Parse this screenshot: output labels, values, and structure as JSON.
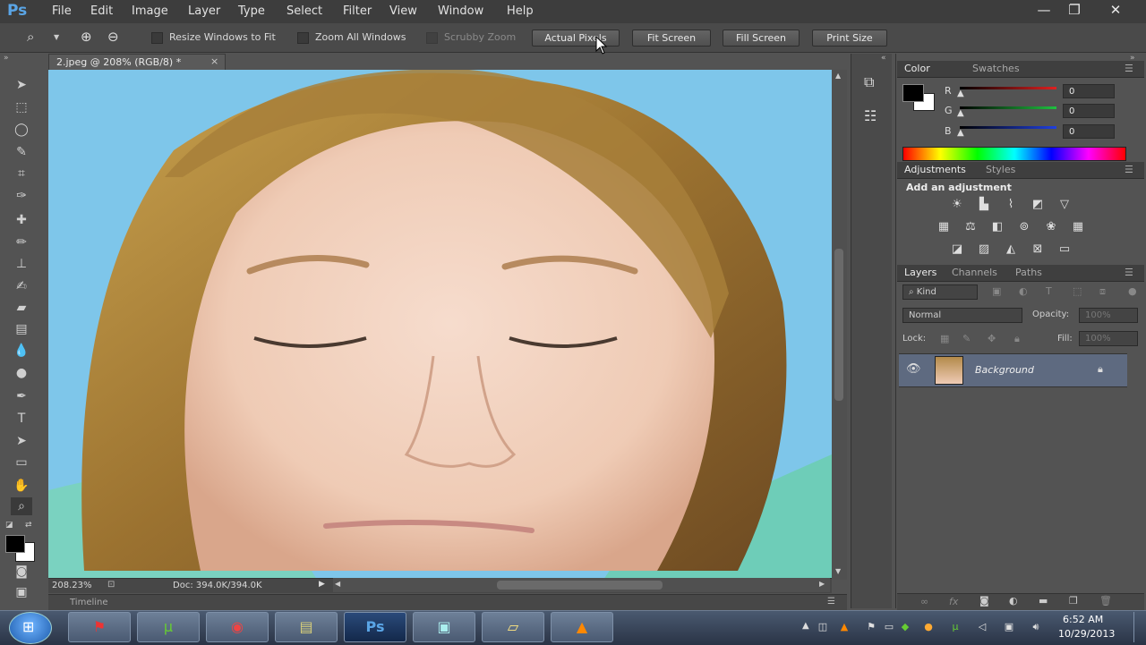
{
  "app": {
    "logo": "Ps"
  },
  "menu": [
    "File",
    "Edit",
    "Image",
    "Layer",
    "Type",
    "Select",
    "Filter",
    "View",
    "Window",
    "Help"
  ],
  "window_controls": {
    "minimize": "—",
    "restore": "❐",
    "close": "✕"
  },
  "options": {
    "resize_windows": "Resize Windows to Fit",
    "zoom_all": "Zoom All Windows",
    "scrubby": "Scrubby Zoom",
    "actual_pixels": "Actual Pixels",
    "fit_screen": "Fit Screen",
    "fill_screen": "Fill Screen",
    "print_size": "Print Size"
  },
  "document": {
    "tab_title": "2.jpeg @ 208% (RGB/8) *",
    "zoom": "208.23%",
    "doc_size": "Doc: 394.0K/394.0K"
  },
  "timeline_label": "Timeline",
  "color_panel": {
    "tabs": [
      "Color",
      "Swatches"
    ],
    "channels": [
      {
        "name": "R",
        "value": "0",
        "color": "#e02020"
      },
      {
        "name": "G",
        "value": "0",
        "color": "#20c040"
      },
      {
        "name": "B",
        "value": "0",
        "color": "#2040e0"
      }
    ]
  },
  "adjustments_panel": {
    "tabs": [
      "Adjustments",
      "Styles"
    ],
    "heading": "Add an adjustment"
  },
  "layers_panel": {
    "tabs": [
      "Layers",
      "Channels",
      "Paths"
    ],
    "kind": "Kind",
    "blend_mode": "Normal",
    "opacity_label": "Opacity:",
    "opacity_value": "100%",
    "lock_label": "Lock:",
    "fill_label": "Fill:",
    "fill_value": "100%",
    "layer_name": "Background"
  },
  "taskbar": {
    "time": "6:52 AM",
    "date": "10/29/2013",
    "ps_label": "Ps"
  }
}
